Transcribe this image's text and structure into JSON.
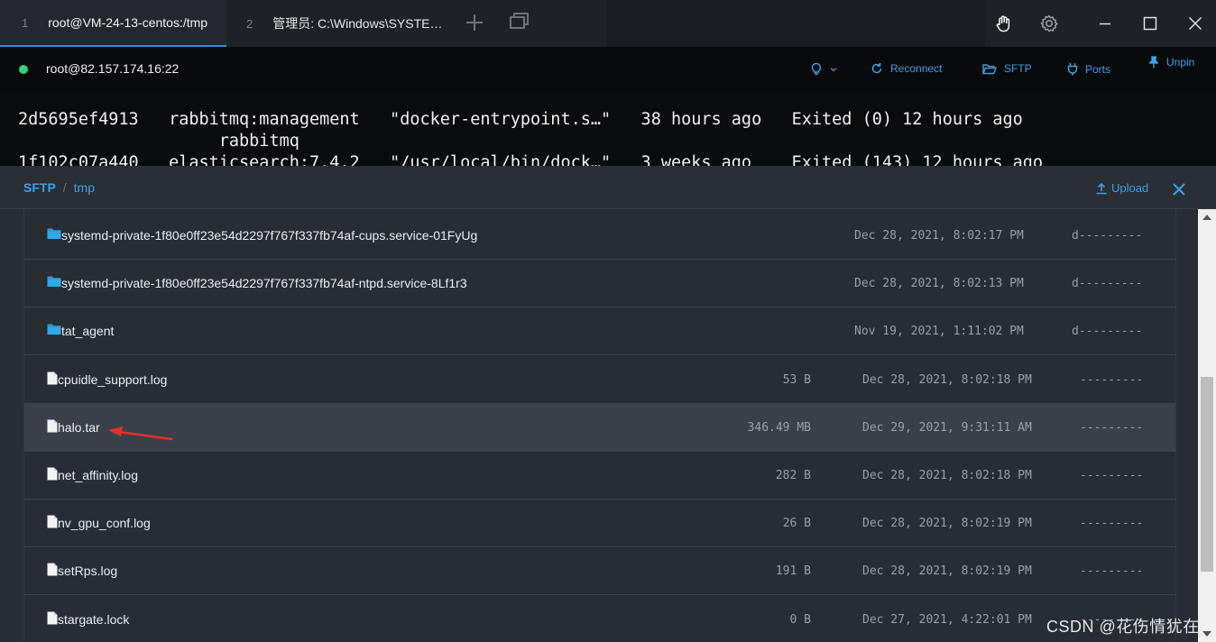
{
  "tabs": [
    {
      "num": "1",
      "title": "root@VM-24-13-centos:/tmp"
    },
    {
      "num": "2",
      "title": "管理员: C:\\Windows\\SYSTE…"
    }
  ],
  "window_controls": [
    "hand-icon",
    "gear-icon",
    "minimize-icon",
    "maximize-icon",
    "close-icon"
  ],
  "host_bar": {
    "host": "root@82.157.174.16:22",
    "reconnect_label": "Reconnect",
    "sftp_label": "SFTP",
    "ports_label": "Ports",
    "unpin_label": "Unpin"
  },
  "terminal": {
    "lines": [
      "2d5695ef4913   rabbitmq:management   \"docker-entrypoint.s…\"   38 hours ago   Exited (0) 12 hours ago",
      "                    rabbitmq",
      "1f102c07a440   elasticsearch:7.4.2   \"/usr/local/bin/dock…\"   3 weeks ago    Exited (143) 12 hours ago"
    ]
  },
  "sftp": {
    "crumb_root": "SFTP",
    "crumb_sep": "/",
    "crumb_dir": "tmp",
    "upload_label": "Upload",
    "rows": [
      {
        "type": "folder",
        "name": "systemd-private-1f80e0ff23e54d2297f767f337fb74af-cups.service-01FyUg",
        "size": "",
        "date": "Dec 28, 2021, 8:02:17 PM",
        "perm": "d---------"
      },
      {
        "type": "folder",
        "name": "systemd-private-1f80e0ff23e54d2297f767f337fb74af-ntpd.service-8Lf1r3",
        "size": "",
        "date": "Dec 28, 2021, 8:02:13 PM",
        "perm": "d---------"
      },
      {
        "type": "folder",
        "name": "tat_agent",
        "size": "",
        "date": "Nov 19, 2021, 1:11:02 PM",
        "perm": "d---------"
      },
      {
        "type": "file",
        "name": "cpuidle_support.log",
        "size": "53 B",
        "date": "Dec 28, 2021, 8:02:18 PM",
        "perm": "---------"
      },
      {
        "type": "file",
        "name": "halo.tar",
        "size": "346.49 MB",
        "date": "Dec 29, 2021, 9:31:11 AM",
        "perm": "---------",
        "selected": true
      },
      {
        "type": "file",
        "name": "net_affinity.log",
        "size": "282 B",
        "date": "Dec 28, 2021, 8:02:18 PM",
        "perm": "---------"
      },
      {
        "type": "file",
        "name": "nv_gpu_conf.log",
        "size": "26 B",
        "date": "Dec 28, 2021, 8:02:19 PM",
        "perm": "---------"
      },
      {
        "type": "file",
        "name": "setRps.log",
        "size": "191 B",
        "date": "Dec 28, 2021, 8:02:19 PM",
        "perm": "---------"
      },
      {
        "type": "file",
        "name": "stargate.lock",
        "size": "0 B",
        "date": "Dec 27, 2021, 4:22:01 PM",
        "perm": "---------"
      }
    ]
  },
  "watermark": "CSDN @花伤情犹在",
  "colors": {
    "accent": "#3aa2e8",
    "status_online": "#2fd27f",
    "arrow": "#e0322f",
    "folder": "#2a9ad6"
  }
}
